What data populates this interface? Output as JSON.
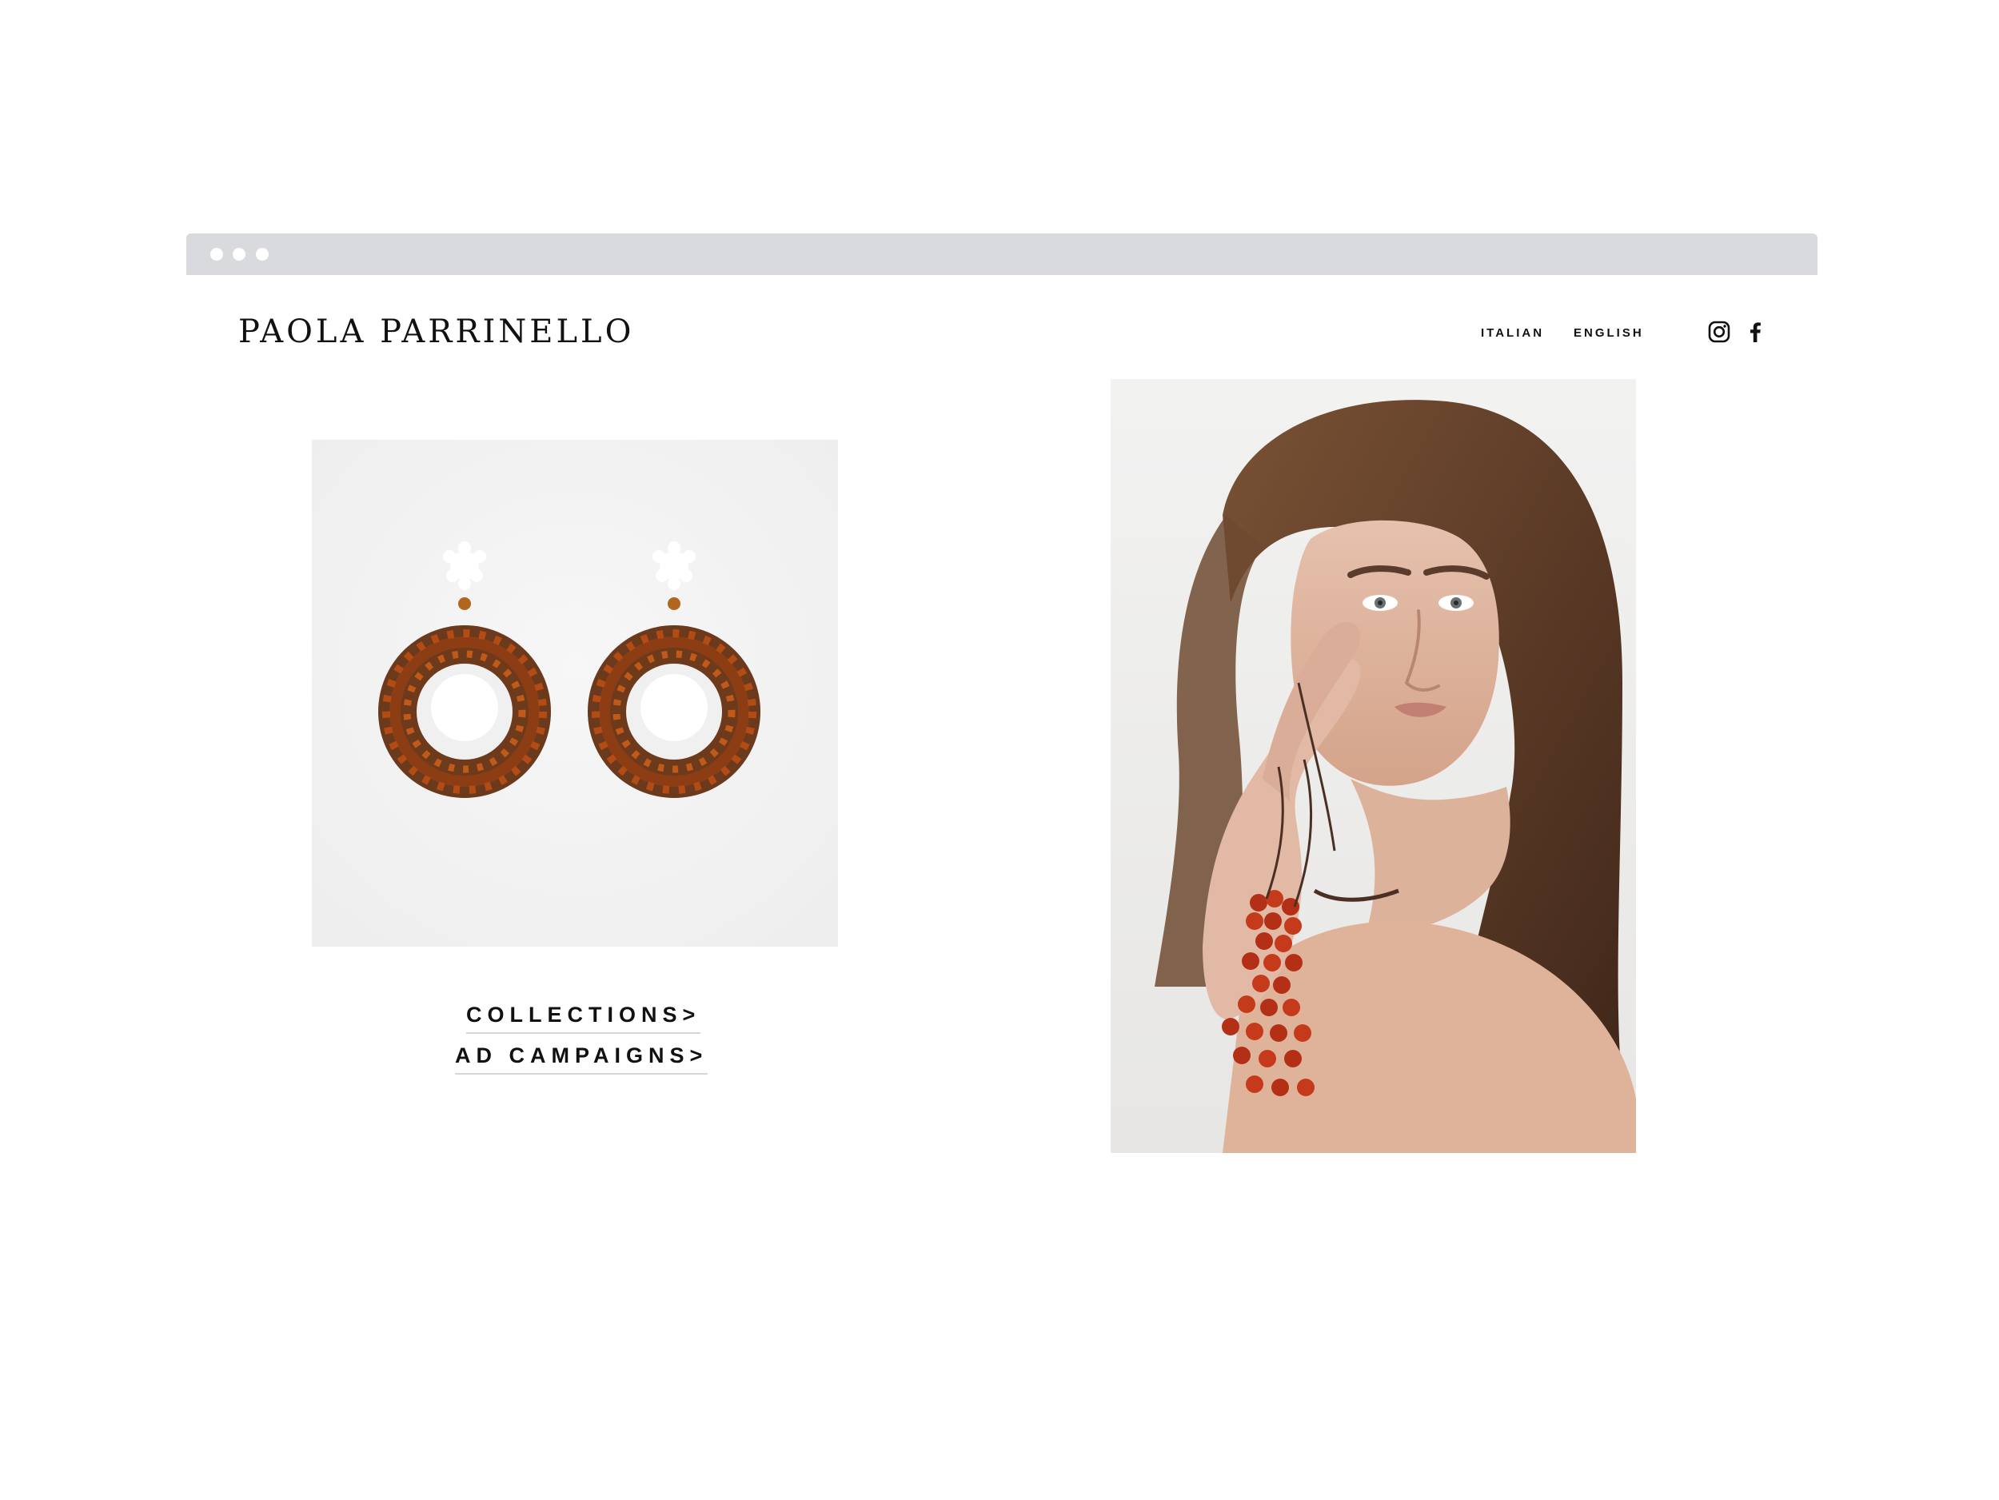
{
  "site": {
    "brand": "PAOLA PARRINELLO",
    "languages": [
      "ITALIAN",
      "ENGLISH"
    ],
    "social_icons": [
      "instagram-icon",
      "facebook-icon"
    ],
    "links": {
      "collections": "COLLECTIONS>",
      "campaigns": "AD CAMPAIGNS>"
    }
  }
}
